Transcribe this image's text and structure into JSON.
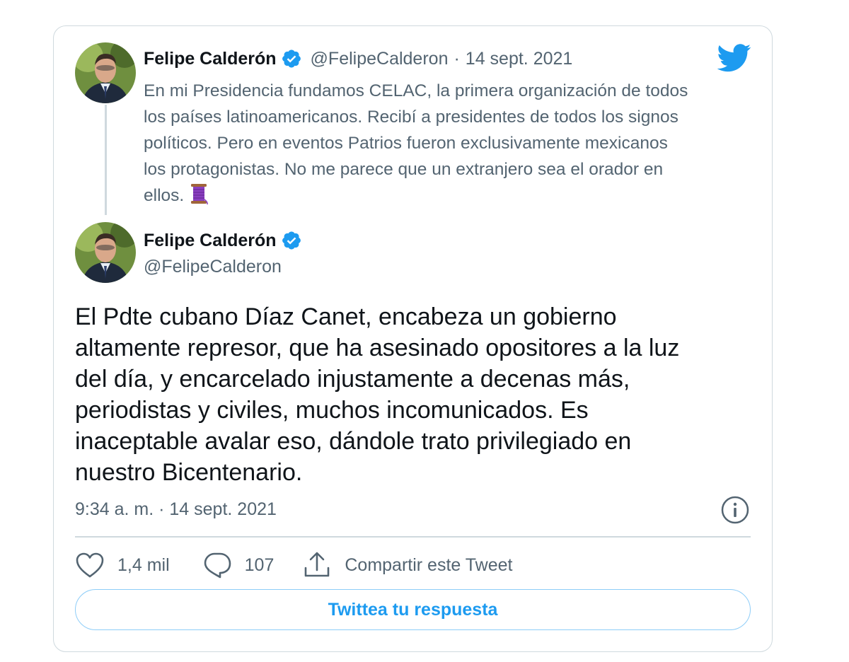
{
  "quoted_tweet": {
    "author_name": "Felipe Calderón",
    "handle": "@FelipeCalderon",
    "separator": "·",
    "date": "14 sept. 2021",
    "text": "En mi Presidencia fundamos CELAC, la primera organización de todos\nlos países latinoamericanos. Recibí a presidentes de todos los signos\npolíticos. Pero en eventos Patrios fueron exclusivamente mexicanos\nlos protagonistas. No me parece que un extranjero sea el orador en\nellos.",
    "emoji_icon": "thread-spool-icon"
  },
  "main_tweet": {
    "author_name": "Felipe Calderón",
    "handle": "@FelipeCalderon",
    "text": "El Pdte cubano Díaz Canet, encabeza un gobierno\naltamente represor, que ha asesinado opositores a la luz\ndel día, y encarcelado injustamente a decenas más,\nperiodistas y civiles, muchos incomunicados. Es\ninaceptable avalar eso, dándole trato privilegiado en\nnuestro Bicentenario.",
    "timestamp": "9:34 a. m. · 14 sept. 2021"
  },
  "actions": {
    "likes": "1,4 mil",
    "replies": "107",
    "share_label": "Compartir este Tweet"
  },
  "reply_button_label": "Twittea tu respuesta",
  "colors": {
    "brand": "#1d9bf0",
    "text_primary": "#0f1419",
    "text_secondary": "#536471",
    "border": "#cfd9de"
  },
  "icons": [
    "twitter-bird-icon",
    "verified-badge-icon",
    "heart-icon",
    "reply-bubble-icon",
    "share-icon",
    "info-icon",
    "thread-spool-icon"
  ]
}
